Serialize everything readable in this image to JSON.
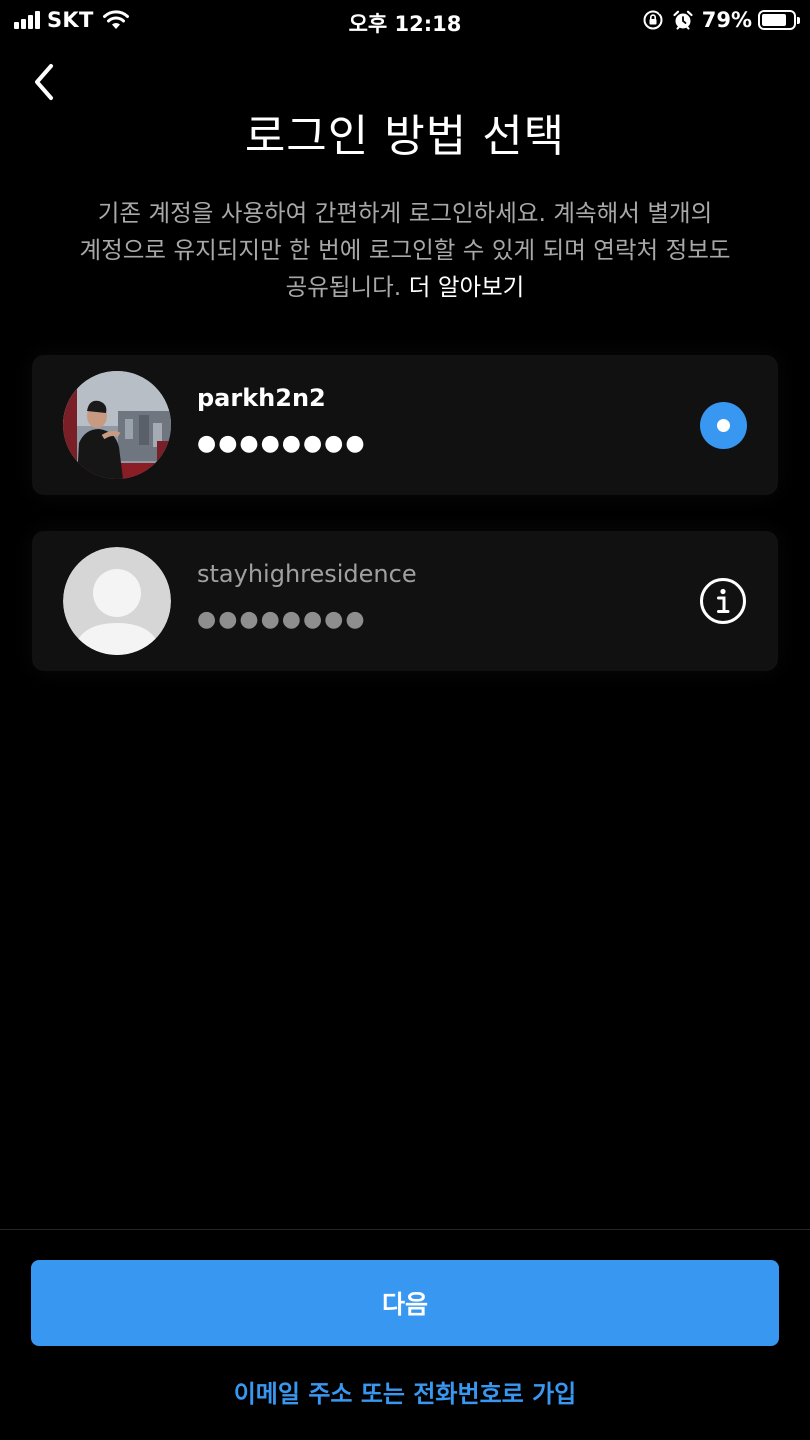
{
  "status_bar": {
    "carrier": "SKT",
    "time": "오후 12:18",
    "battery_percent": "79%",
    "battery_level": 0.79,
    "icons": [
      "signal-icon",
      "wifi-icon",
      "orientation-lock-icon",
      "alarm-icon",
      "battery-icon"
    ]
  },
  "header": {
    "back_icon": "chevron-left-icon",
    "title": "로그인 방법 선택"
  },
  "description": {
    "text": "기존 계정을 사용하여 간편하게 로그인하세요. 계속해서 별개의 계정으로 유지되지만 한 번에 로그인할 수 있게 되며 연락처 정보도 공유됩니다.",
    "link_label": "더 알아보기"
  },
  "accounts": [
    {
      "username": "parkh2n2",
      "password_mask": "●●●●●●●●",
      "selected": true,
      "trailing_icon": "radio-selected-icon"
    },
    {
      "username": "stayhighresidence",
      "password_mask": "●●●●●●●●",
      "selected": false,
      "trailing_icon": "info-icon"
    }
  ],
  "footer": {
    "next_label": "다음",
    "signup_label": "이메일 주소 또는 전화번호로 가입"
  },
  "colors": {
    "accent": "#3897f0",
    "background": "#000000",
    "card": "#111111",
    "secondary_text": "#a8a8a8"
  }
}
